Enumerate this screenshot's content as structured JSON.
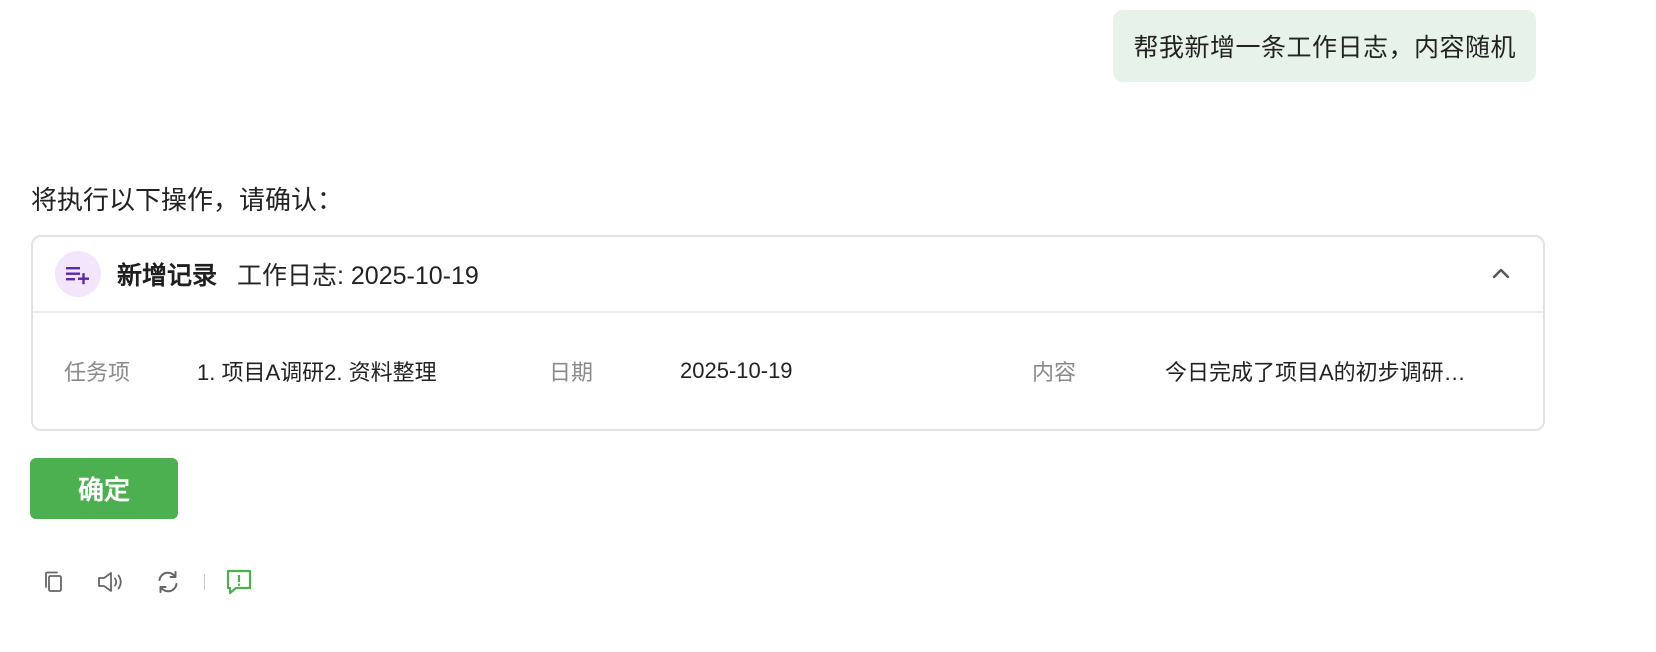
{
  "user_message": {
    "text": "帮我新增一条工作日志，内容随机"
  },
  "assistant": {
    "intro": "将执行以下操作，请确认："
  },
  "operation_card": {
    "icon": "add-list-icon",
    "icon_color": "#5b2aa8",
    "icon_bg": "#f3e5fb",
    "title": "新增记录",
    "target": "工作日志: 2025-10-19",
    "collapse_icon": "chevron-up-icon",
    "fields": [
      {
        "label": "任务项",
        "value": "1. 项目A调研2. 资料整理"
      },
      {
        "label": "日期",
        "value": "2025-10-19"
      },
      {
        "label": "内容",
        "value": "今日完成了项目A的初步调研…"
      }
    ]
  },
  "confirm_button": {
    "label": "确定",
    "color": "#4caf50"
  },
  "toolbar": {
    "icons": [
      "copy-icon",
      "speaker-icon",
      "refresh-icon",
      "feedback-icon"
    ],
    "feedback_color": "#4caf50"
  }
}
